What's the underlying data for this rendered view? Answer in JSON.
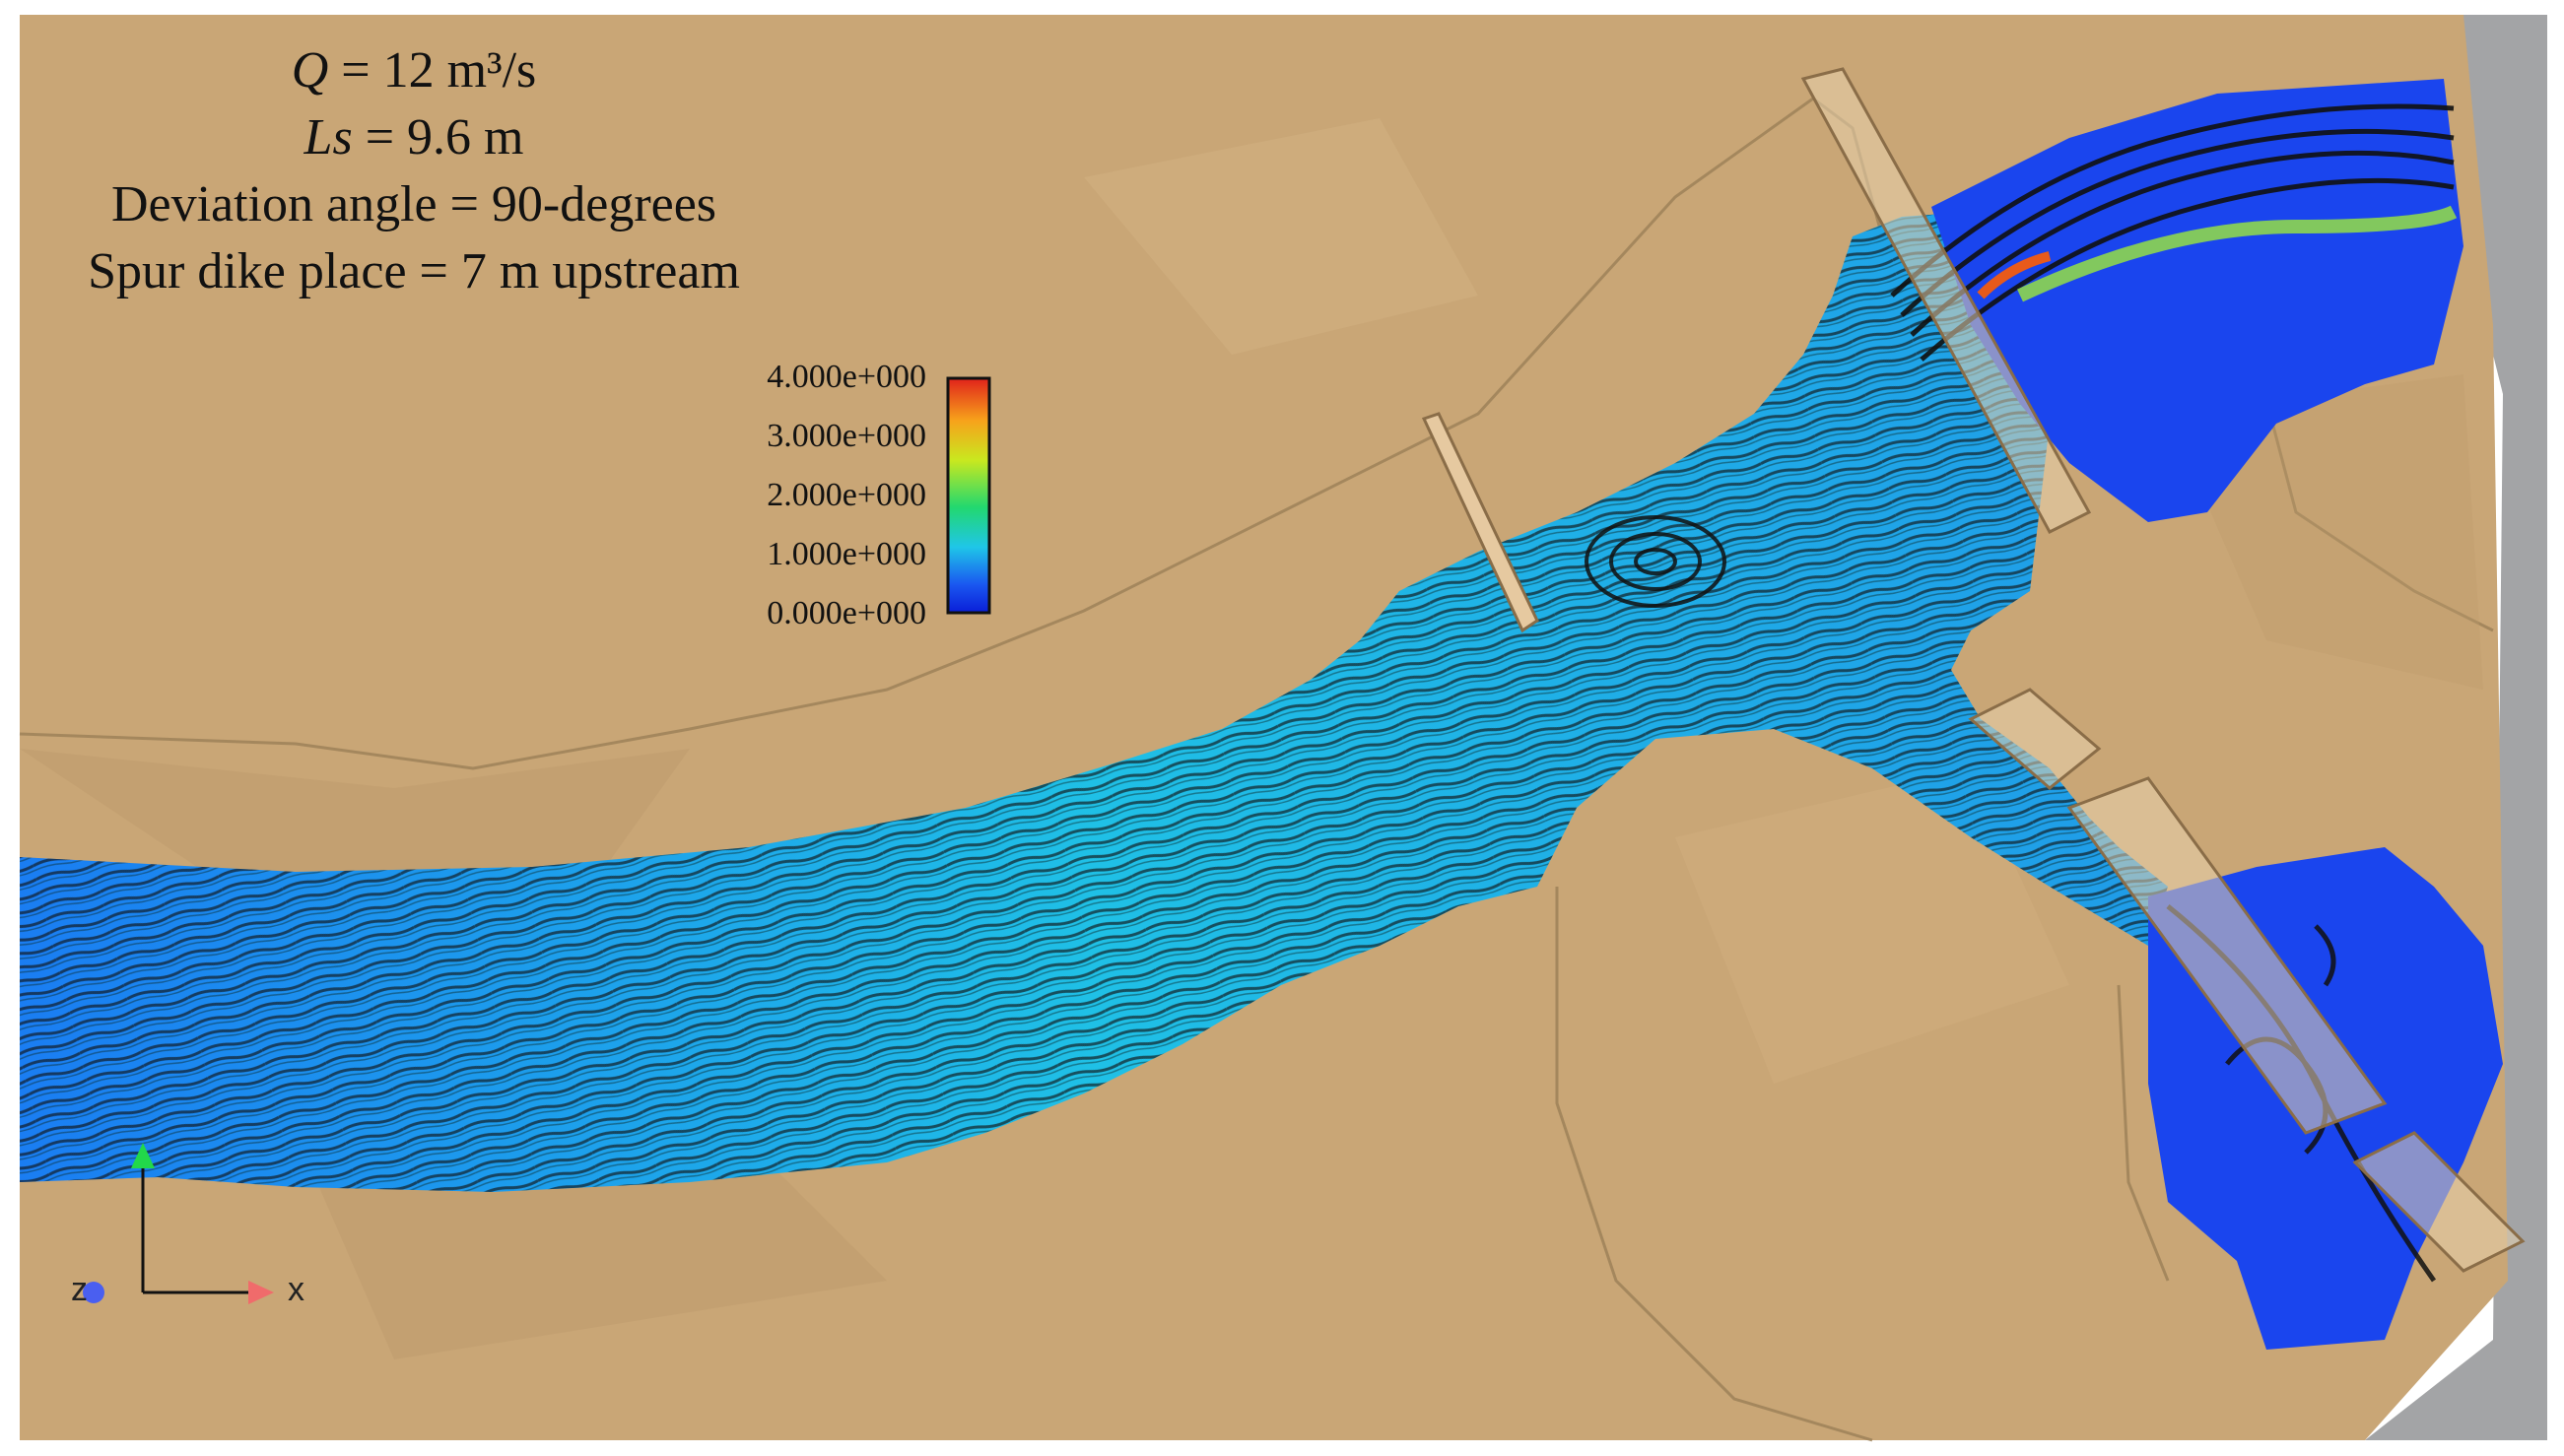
{
  "parameters": {
    "q_var": "Q",
    "q_value": "= 12 m³/s",
    "ls_var": "Ls",
    "ls_value": "= 9.6 m",
    "deviation": "Deviation angle = 90-degrees",
    "spur_place": "Spur dike place = 7 m upstream"
  },
  "legend": {
    "ticks": [
      "4.000e+000",
      "3.000e+000",
      "2.000e+000",
      "1.000e+000",
      "0.000e+000"
    ],
    "colors": [
      "#e0231b",
      "#f7a21b",
      "#c9e81f",
      "#22d86f",
      "#1fc6e8",
      "#1a57f0",
      "#0a1ed8"
    ]
  },
  "axes": {
    "x_label": "x",
    "z_label": "z"
  },
  "colors": {
    "terrain": "#c9a676",
    "terrain_dark": "#b8956a",
    "background_gray": "#a3a4a6",
    "water_deep": "#1a4ff0",
    "water_mid": "#1fb8e8",
    "streamline": "#1a1a1a"
  }
}
